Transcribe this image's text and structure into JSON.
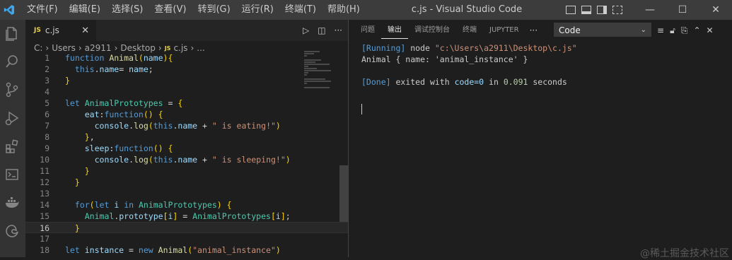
{
  "titlebar": {
    "menu": [
      "文件(F)",
      "编辑(E)",
      "选择(S)",
      "查看(V)",
      "转到(G)",
      "运行(R)",
      "终端(T)",
      "帮助(H)"
    ],
    "title": "c.js - Visual Studio Code",
    "minimize": "—",
    "maximize": "☐",
    "close": "✕"
  },
  "activitybar": [
    "explorer-icon",
    "search-icon",
    "source-control-icon",
    "run-debug-icon",
    "extensions-icon",
    "remote-explorer-icon",
    "docker-icon",
    "edge-icon"
  ],
  "editor": {
    "tab": {
      "badge": "JS",
      "label": "c.js",
      "close": "✕"
    },
    "breadcrumb": {
      "parts": [
        "C:",
        "Users",
        "a2911",
        "Desktop"
      ],
      "badge": "JS",
      "file": "c.js",
      "ellipsis": "..."
    },
    "current_line": 16,
    "lines": [
      {
        "n": "1",
        "t": "function Animal(name){"
      },
      {
        "n": "2",
        "t": "  this.name= name;"
      },
      {
        "n": "3",
        "t": "}"
      },
      {
        "n": "4",
        "t": ""
      },
      {
        "n": "5",
        "t": "let AnimalPrototypes = {"
      },
      {
        "n": "6",
        "t": "    eat:function() {"
      },
      {
        "n": "7",
        "t": "      console.log(this.name + \" is eating!\")"
      },
      {
        "n": "8",
        "t": "    },"
      },
      {
        "n": "9",
        "t": "    sleep:function() {"
      },
      {
        "n": "10",
        "t": "      console.log(this.name + \" is sleeping!\")"
      },
      {
        "n": "11",
        "t": "    }"
      },
      {
        "n": "12",
        "t": "  }"
      },
      {
        "n": "13",
        "t": ""
      },
      {
        "n": "14",
        "t": "  for(let i in AnimalPrototypes) {"
      },
      {
        "n": "15",
        "t": "    Animal.prototype[i] = AnimalPrototypes[i];"
      },
      {
        "n": "16",
        "t": "  }"
      },
      {
        "n": "17",
        "t": ""
      },
      {
        "n": "18",
        "t": "let instance = new Animal(\"animal_instance\")"
      }
    ]
  },
  "panel": {
    "tabs": [
      "问题",
      "输出",
      "调试控制台",
      "终端",
      "JUPYTER"
    ],
    "active_tab": "输出",
    "more": "···",
    "select_value": "Code",
    "output": {
      "running_tag": "[Running]",
      "running_cmd": " node ",
      "running_path": "\"c:\\Users\\a2911\\Desktop\\c.js\"",
      "result": "Animal { name: 'animal_instance' }",
      "done_tag": "[Done]",
      "done_text1": " exited with ",
      "done_code": "code=0",
      "done_text2": " in ",
      "done_time": "0.091",
      "done_text3": " seconds"
    }
  },
  "watermark": "@稀土掘金技术社区"
}
